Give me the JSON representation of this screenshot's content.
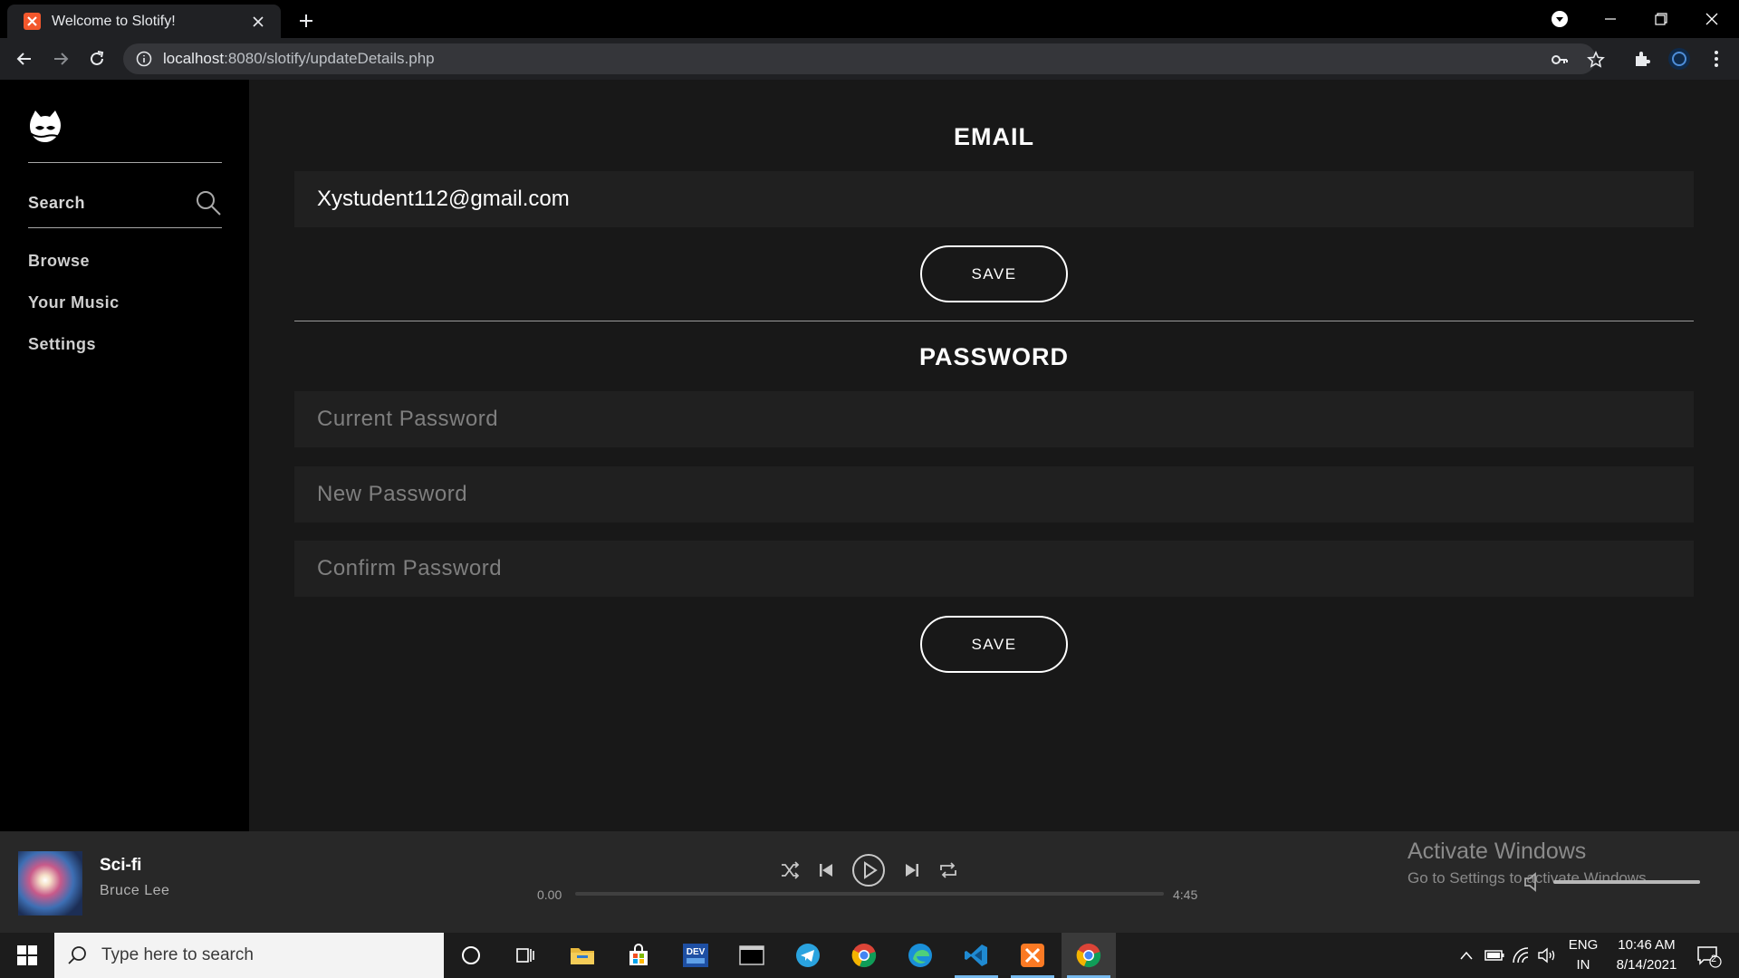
{
  "browser": {
    "tab_title": "Welcome to Slotify!",
    "url_host": "localhost",
    "url_path": ":8080/slotify/updateDetails.php"
  },
  "sidebar": {
    "search_label": "Search",
    "nav": [
      {
        "label": "Browse"
      },
      {
        "label": "Your Music"
      },
      {
        "label": "Settings"
      }
    ]
  },
  "email_section": {
    "title": "EMAIL",
    "email_value": "Xystudent112@gmail.com",
    "save_label": "SAVE"
  },
  "password_section": {
    "title": "PASSWORD",
    "current_placeholder": "Current Password",
    "new_placeholder": "New Password",
    "confirm_placeholder": "Confirm Password",
    "save_label": "SAVE"
  },
  "player": {
    "song_title": "Sci-fi",
    "artist": "Bruce Lee",
    "time_current": "0.00",
    "time_total": "4:45",
    "progress": 0.0,
    "volume": 1.0
  },
  "watermark": {
    "title": "Activate Windows",
    "subtitle": "Go to Settings to activate Windows."
  },
  "taskbar": {
    "search_placeholder": "Type here to search",
    "lang_top": "ENG",
    "lang_bottom": "IN",
    "time": "10:46 AM",
    "date": "8/14/2021",
    "notification_count": "2"
  }
}
